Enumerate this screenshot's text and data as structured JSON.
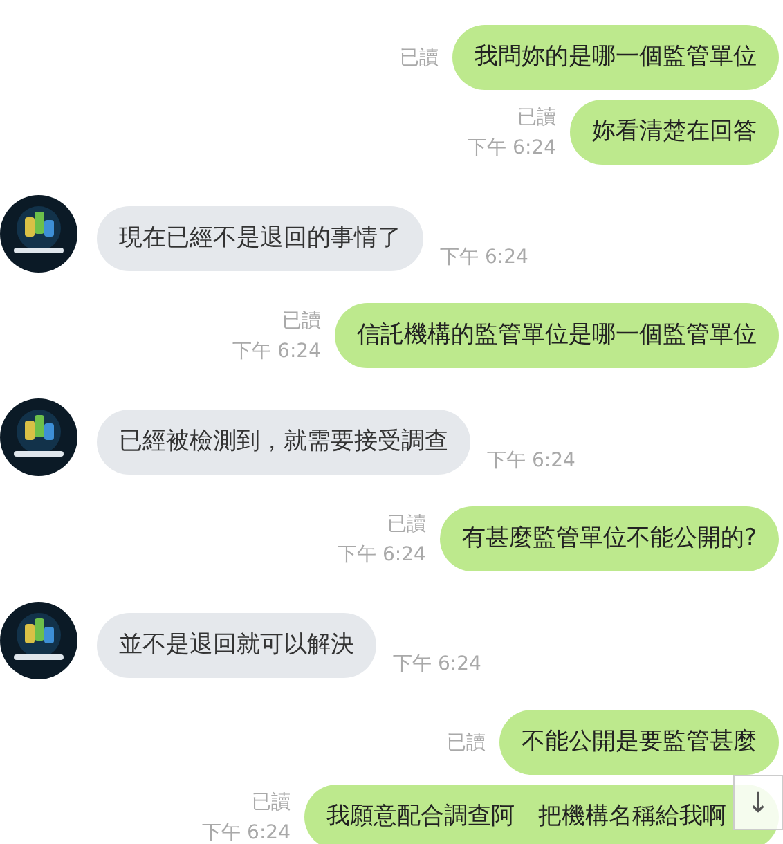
{
  "messages": [
    {
      "kind": "sent",
      "text": "我問妳的是哪一個監管單位",
      "read": "已讀"
    },
    {
      "kind": "sent",
      "text": "妳看清楚在回答",
      "read": "已讀",
      "time": "下午 6:24"
    },
    {
      "kind": "received",
      "text": "現在已經不是退回的事情了",
      "time": "下午 6:24"
    },
    {
      "kind": "sent",
      "text": "信託機構的監管單位是哪一個監管單位",
      "read": "已讀",
      "time": "下午 6:24"
    },
    {
      "kind": "received",
      "text": "已經被檢測到，就需要接受調查",
      "time": "下午 6:24"
    },
    {
      "kind": "sent",
      "text": "有甚麼監管單位不能公開的?",
      "read": "已讀",
      "time": "下午 6:24"
    },
    {
      "kind": "received",
      "text": "並不是退回就可以解決",
      "time": "下午 6:24"
    },
    {
      "kind": "sent",
      "text": "不能公開是要監管甚麼",
      "read": "已讀"
    },
    {
      "kind": "sent",
      "text": "我願意配合調查阿　把機構名稱給我啊",
      "read": "已讀",
      "time": "下午 6:24"
    }
  ],
  "scroll_button": {
    "label": "↓"
  }
}
